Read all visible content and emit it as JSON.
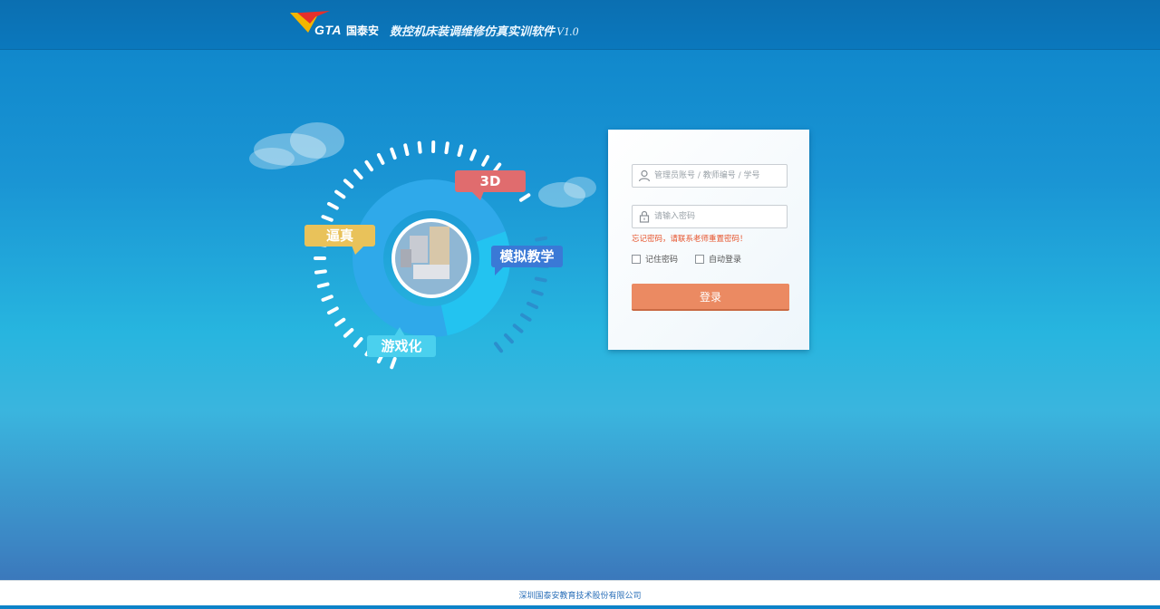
{
  "header": {
    "brand_logo_text": "GTA",
    "brand_name": "国泰安",
    "app_title": "数控机床装调维修仿真实训软件",
    "app_version": "V1.0"
  },
  "hero": {
    "bubble_3d": "3D",
    "bubble_realistic": "逼真",
    "bubble_simulation": "模拟教学",
    "bubble_gamified": "游戏化"
  },
  "login": {
    "username_placeholder": "管理员账号 / 教师编号 / 学号",
    "password_placeholder": "请输入密码",
    "forgot_text": "忘记密码，请联系老师重置密码！",
    "remember_label": "记住密码",
    "auto_login_label": "自动登录",
    "submit_label": "登录"
  },
  "footer": {
    "company": "深圳国泰安教育技术股份有限公司"
  },
  "colors": {
    "accent_button": "#eb8a62",
    "error_text": "#e6532c",
    "header_bg": "#0b78bd",
    "ring_blue": "#2fa9ea"
  },
  "icons": {
    "user": "user-icon",
    "lock": "lock-icon"
  }
}
